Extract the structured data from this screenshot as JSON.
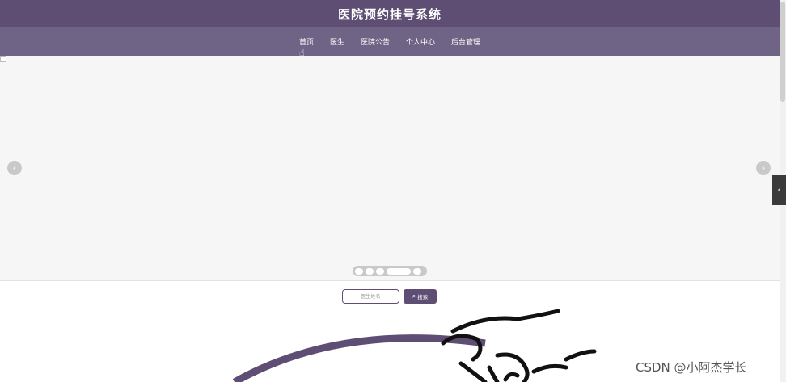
{
  "header": {
    "title": "医院预约挂号系统"
  },
  "nav": {
    "items": [
      {
        "label": "首页",
        "active": true
      },
      {
        "label": "医生"
      },
      {
        "label": "医院公告"
      },
      {
        "label": "个人中心"
      },
      {
        "label": "后台管理"
      }
    ]
  },
  "carousel": {
    "prev_icon": "chevron-left-icon",
    "next_icon": "chevron-right-icon",
    "slide_count": 5,
    "active_slide": 4
  },
  "search": {
    "placeholder": "医生姓名",
    "button_label": "搜索",
    "icon": "search-icon"
  },
  "watermark": {
    "text": "CSDN @小阿杰学长"
  },
  "colors": {
    "primary": "#5f4e73",
    "nav": "#6f6485",
    "carousel_bg": "#f6f6f6"
  }
}
